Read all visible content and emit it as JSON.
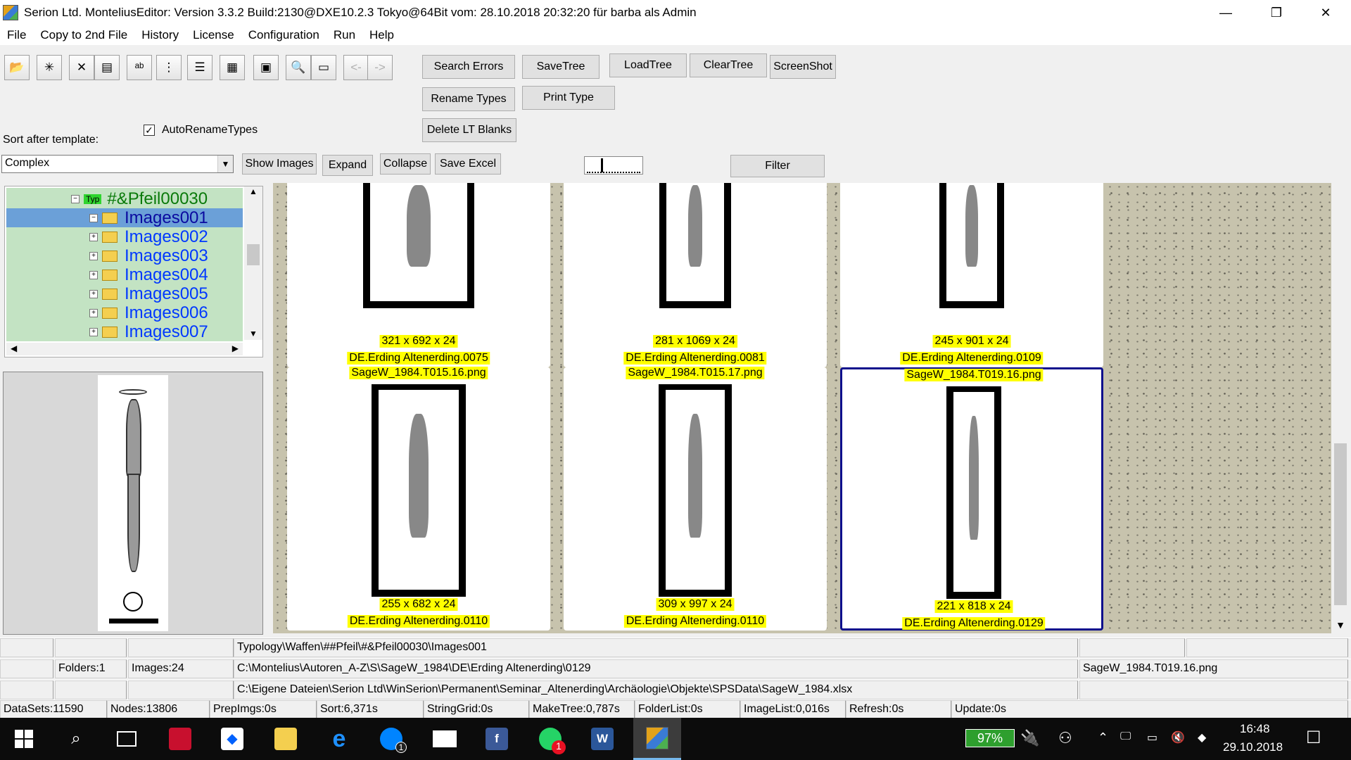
{
  "window": {
    "title": "Serion Ltd. MonteliusEditor: Version  3.3.2 Build:2130@DXE10.2.3 Tokyo@64Bit vom: 28.10.2018 20:32:20 für barba als Admin",
    "minimize": "—",
    "maximize": "❐",
    "close": "✕"
  },
  "menu": [
    "File",
    "Copy to 2nd File",
    "History",
    "License",
    "Configuration",
    "Run",
    "Help"
  ],
  "toolbar": {
    "icons": [
      "open-folder-icon",
      "new-folder-icon",
      "delete-icon",
      "properties-icon",
      "rename-icon",
      "tree-icon",
      "list-icon",
      "grid-icon",
      "thumbnails-icon",
      "search-icon",
      "image-list-icon",
      "back-arrow-icon",
      "forward-arrow-icon"
    ],
    "back_label": "<-",
    "forward_label": "->",
    "search_errors": "Search Errors",
    "save_tree": "SaveTree",
    "load_tree": "LoadTree",
    "clear_tree": "ClearTree",
    "screenshot": "ScreenShot",
    "rename_types": "Rename Types",
    "print_type": "Print Type",
    "delete_lt_blanks": "Delete LT Blanks",
    "auto_rename_label": "AutoRenameTypes",
    "auto_rename_checked": "✓",
    "sort_label": "Sort after template:",
    "sort_value": "Complex",
    "show_images": "Show Images",
    "expand": "Expand",
    "collapse": "Collapse",
    "save_excel": "Save Excel",
    "filter": "Filter",
    "zoom_level": 0.3
  },
  "tree": {
    "root": "#&Pfeil00030",
    "root_icon_text": "Typ",
    "items": [
      "Images001",
      "Images002",
      "Images003",
      "Images004",
      "Images005",
      "Images006",
      "Images007"
    ],
    "selected_index": 0
  },
  "gallery": {
    "cards": [
      {
        "filename": "",
        "dims": "321 x 692 x 24",
        "site": "DE.Erding Altenerding.0075",
        "active": false
      },
      {
        "filename": "",
        "dims": "281 x 1069 x 24",
        "site": "DE.Erding Altenerding.0081",
        "active": false
      },
      {
        "filename": "",
        "dims": "245 x 901 x 24",
        "site": "DE.Erding Altenerding.0109",
        "active": false
      },
      {
        "filename": "SageW_1984.T015.16.png",
        "dims": "255 x 682 x 24",
        "site": "DE.Erding Altenerding.0110",
        "active": false
      },
      {
        "filename": "SageW_1984.T015.17.png",
        "dims": "309 x 997 x 24",
        "site": "DE.Erding Altenerding.0110",
        "active": false
      },
      {
        "filename": "SageW_1984.T019.16.png",
        "dims": "221 x 818 x 24",
        "site": "DE.Erding Altenerding.0129",
        "active": true
      }
    ]
  },
  "status": {
    "path": "Typology\\Waffen\\##Pfeil\\#&Pfeil00030\\Images001",
    "folders": "Folders:1",
    "images": "Images:24",
    "dir": "C:\\Montelius\\Autoren_A-Z\\S\\SageW_1984\\DE\\Erding Altenerding\\0129",
    "current_file": "SageW_1984.T019.16.png",
    "xlsx": "C:\\Eigene Dateien\\Serion Ltd\\WinSerion\\Permanent\\Seminar_Altenerding\\Archäologie\\Objekte\\SPSData\\SageW_1984.xlsx",
    "timings": [
      "DataSets:11590",
      "Nodes:13806",
      "PrepImgs:0s",
      "Sort:6,371s",
      "StringGrid:0s",
      "MakeTree:0,787s",
      "FolderList:0s",
      "ImageList:0,016s",
      "Refresh:0s",
      "Update:0s"
    ]
  },
  "taskbar": {
    "apps": [
      "start-icon",
      "search-icon",
      "task-view-icon",
      "mcafee-icon",
      "dropbox-icon",
      "file-explorer-icon",
      "edge-icon",
      "messenger-icon",
      "mail-icon",
      "facebook-icon",
      "whatsapp-icon",
      "word-icon",
      "montelius-icon"
    ],
    "messenger_badge": "1",
    "whatsapp_badge": "1",
    "battery": "97%",
    "time": "16:48",
    "date": "29.10.2018"
  },
  "colors": {
    "tree_bg": "#c3e3c3",
    "selection": "#6ba0d8",
    "label_bg": "#ffff00",
    "active_border": "#0d0f8c",
    "taskbar": "#0c0c0c"
  }
}
